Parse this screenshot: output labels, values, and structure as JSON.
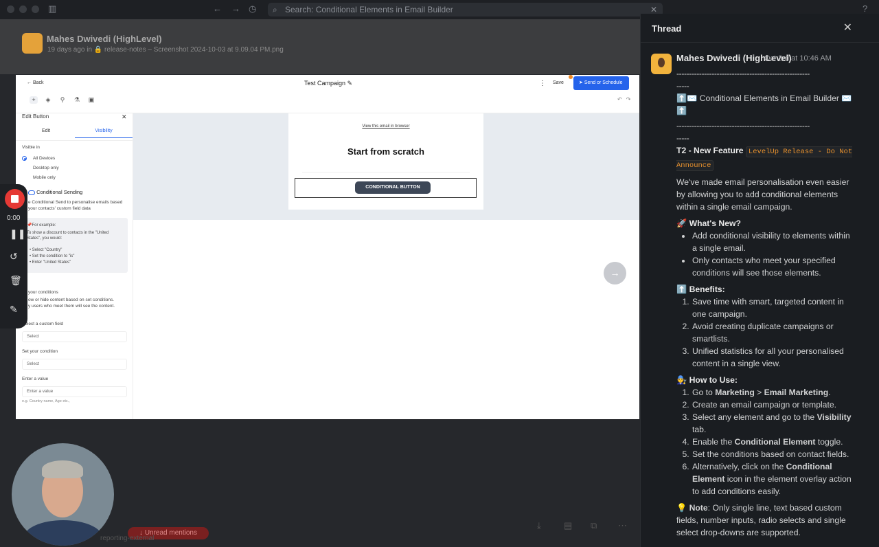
{
  "search": {
    "placeholder": "Search: Conditional Elements in Email Builder"
  },
  "post": {
    "author": "Mahes Dwivedi (HighLevel)",
    "meta": "19 days ago in 🔒 release-notes  – Screenshot 2024-10-03 at 9.09.04 PM.png"
  },
  "builder": {
    "back": "Back",
    "campaign_title": "Test Campaign",
    "save": "Save",
    "send": "Send or Schedule",
    "panel_title": "Edit Button",
    "tab_edit": "Edit",
    "tab_visibility": "Visibility",
    "visible_in": "Visible in",
    "opt_all": "All Devices",
    "opt_desktop": "Desktop only",
    "opt_mobile": "Mobile only",
    "conditional_sending": "Conditional Sending",
    "cs_desc1": "e Conditional Send to personalise emails based",
    "cs_desc2": "your contacts' custom field data",
    "example_title": "For example:",
    "example_1": "To show a discount to contacts in the \"United",
    "example_2": "States\", you would:",
    "example_b1": "Select \"Country\"",
    "example_b2": "Set the condition to \"is\"",
    "example_b3": "Enter \"United States\"",
    "conditions_title": "your conditions",
    "conditions_1": "ow or hide content based on set conditions.",
    "conditions_2": "y users who meet them will see the content.",
    "custom_field_label": "Select a custom field",
    "custom_field_value": "Select",
    "condition_label": "Set your condition",
    "condition_value": "Select",
    "value_label": "Enter a value",
    "value_placeholder": "Enter a value",
    "value_hint": "e.g. Country name, Age etc.,",
    "view_browser": "View this email in browser",
    "heading": "Start from scratch",
    "cond_button": "CONDITIONAL BUTTON"
  },
  "recorder": {
    "time": "0:00"
  },
  "bottom": {
    "badge": "Unread mentions",
    "channel": "reporting-external"
  },
  "thread": {
    "title": "Thread",
    "author": "Mahes Dwivedi (HighLevel)",
    "time": "Oct 3rd at 10:46 AM",
    "dash": "-----------------------------------------------------",
    "dash_tail": "-----",
    "headline": "Conditional Elements  in Email Builder",
    "feature": "T2 - New Feature",
    "code": "LevelUp Release - Do Not Announce",
    "intro": "We've made email personalisation even easier by allowing you to add conditional elements within a single email campaign.",
    "whats_new_title": "What's New?",
    "whats_new": [
      "Add conditional visibility to elements within a single email.",
      "Only contacts who meet your specified conditions will see those elements."
    ],
    "benefits_title": "Benefits:",
    "benefits": [
      "Save time with smart, targeted content in one campaign.",
      "Avoid creating duplicate campaigns or smartlists.",
      "Unified statistics for all your personalised content in a single view."
    ],
    "howto_title": "How to Use:",
    "howto_1a": "Go to ",
    "howto_1b": "Marketing",
    "howto_1c": " > ",
    "howto_1d": "Email Marketing",
    "howto_1e": ".",
    "howto_2": "Create an email campaign or template.",
    "howto_3a": "Select any element and go to the ",
    "howto_3b": "Visibility",
    "howto_3c": " tab.",
    "howto_4a": "Enable the ",
    "howto_4b": "Conditional Element",
    "howto_4c": " toggle.",
    "howto_5": "Set the conditions based on contact fields.",
    "howto_6a": "Alternatively, click on the ",
    "howto_6b": "Conditional Element",
    "howto_6c": " icon in the element overlay action to add conditions easily.",
    "note_label": "Note",
    "note_text": ": Only single line, text based custom fields, number inputs, radio selects and single select drop-downs are supported."
  }
}
